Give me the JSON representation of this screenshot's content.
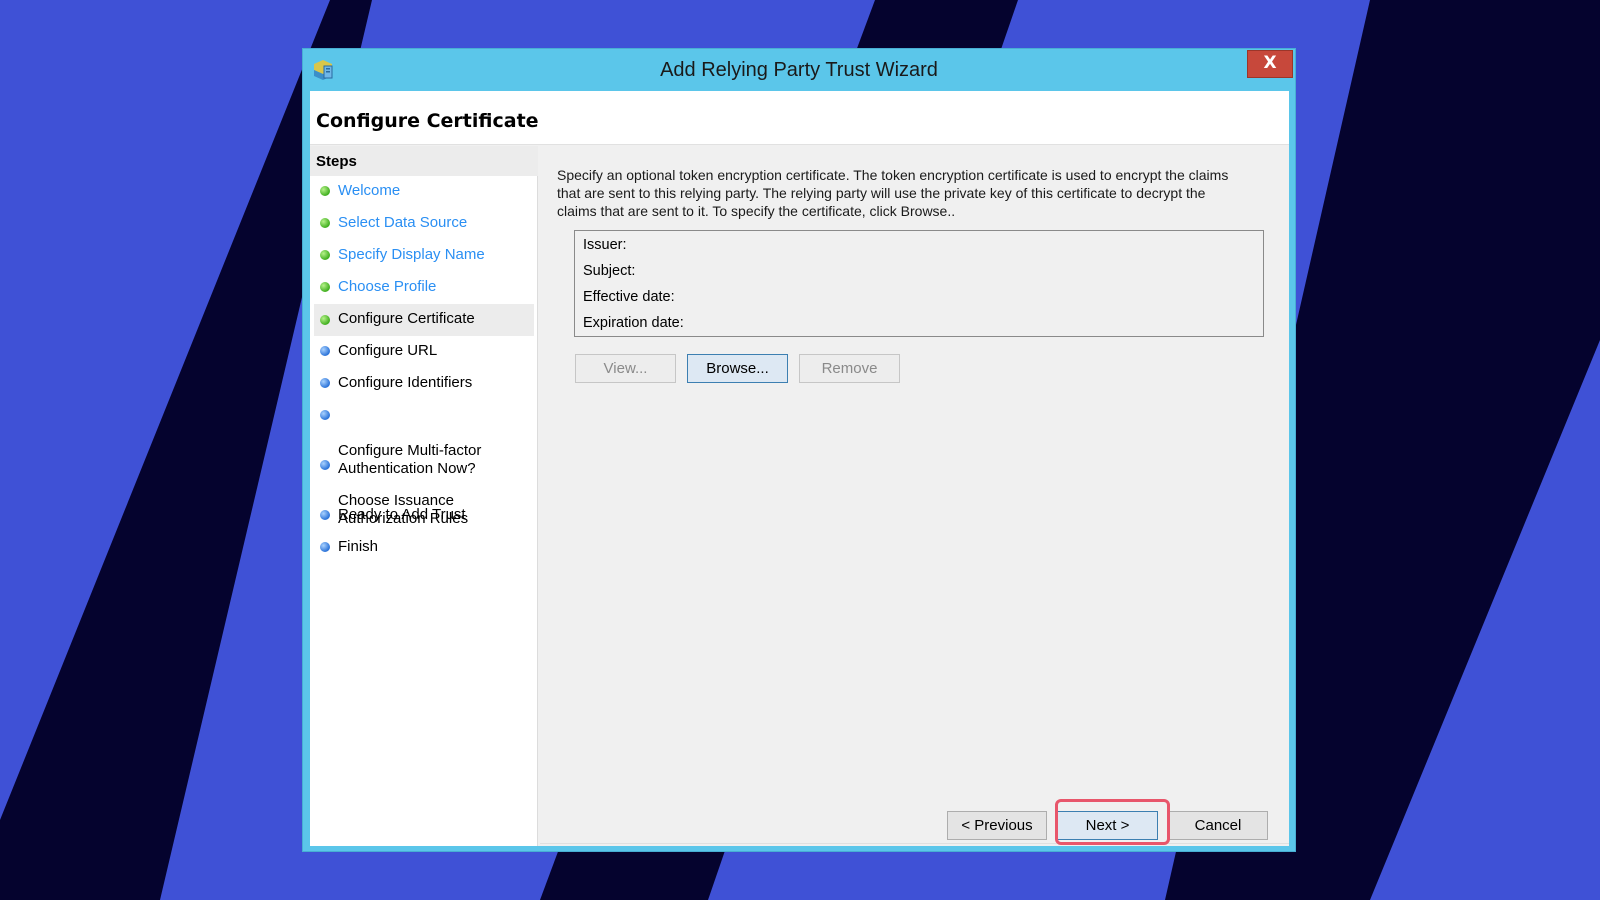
{
  "window": {
    "title": "Add Relying Party Trust Wizard",
    "close_label": "X",
    "page_title": "Configure Certificate"
  },
  "steps": {
    "heading": "Steps",
    "items": [
      {
        "label": "Welcome",
        "state": "done"
      },
      {
        "label": "Select Data Source",
        "state": "done"
      },
      {
        "label": "Specify Display Name",
        "state": "done"
      },
      {
        "label": "Choose Profile",
        "state": "done"
      },
      {
        "label": "Configure Certificate",
        "state": "current"
      },
      {
        "label": "Configure URL",
        "state": "pending"
      },
      {
        "label": "Configure Identifiers",
        "state": "pending"
      },
      {
        "label": "Configure Multi-factor\nAuthentication Now?",
        "state": "pending"
      },
      {
        "label": "Choose Issuance\nAuthorization Rules",
        "state": "pending"
      },
      {
        "label": "Ready to Add Trust",
        "state": "pending"
      },
      {
        "label": "Finish",
        "state": "pending"
      }
    ]
  },
  "content": {
    "description": "Specify an optional token encryption certificate.  The token encryption certificate is used to encrypt the claims that are sent to this relying party.  The relying party will use the private key of this certificate to decrypt the claims that are sent to it.  To specify the certificate, click Browse..",
    "certificate": {
      "issuer_label": "Issuer:",
      "subject_label": "Subject:",
      "effective_label": "Effective date:",
      "expiration_label": "Expiration date:"
    },
    "buttons": {
      "view": "View...",
      "browse": "Browse...",
      "remove": "Remove"
    }
  },
  "footer": {
    "previous": "< Previous",
    "next": "Next >",
    "cancel": "Cancel"
  },
  "colors": {
    "background": "#3f51d6",
    "stripe": "#05032e",
    "titlebar": "#5bc6ea",
    "close": "#c7483b",
    "done_link": "#2a8ff3",
    "highlight": "#e8566b"
  }
}
